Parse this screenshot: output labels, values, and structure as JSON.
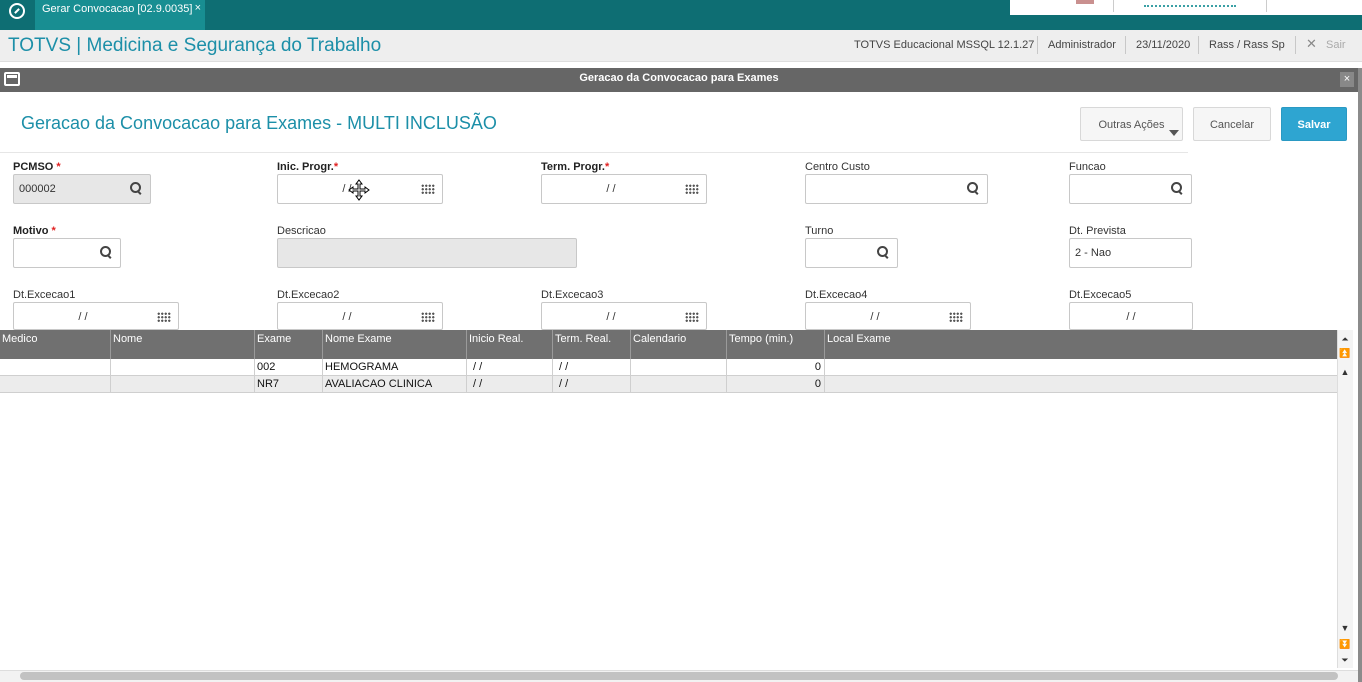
{
  "tab": {
    "label": "Gerar Convocacao [02.9.0035]",
    "close": "×"
  },
  "header": {
    "app_title": "TOTVS | Medicina e Segurança do Trabalho",
    "environment": "TOTVS Educacional MSSQL 12.1.27",
    "user": "Administrador",
    "date": "23/11/2020",
    "branch": "Rass / Rass Sp",
    "exit_label": "Sair"
  },
  "dialog": {
    "title": "Geracao da Convocacao para Exames",
    "close": "×",
    "heading": "Geracao da Convocacao para Exames - MULTI INCLUSÃO",
    "buttons": {
      "other_actions": "Outras Ações",
      "cancel": "Cancelar",
      "save": "Salvar"
    }
  },
  "form": {
    "pcmso": {
      "label": "PCMSO",
      "required": "*",
      "value": "000002"
    },
    "inic_progr": {
      "label": "Inic. Progr.",
      "required": "*",
      "value": "/ /"
    },
    "term_progr": {
      "label": "Term. Progr.",
      "required": "*",
      "value": "/ /"
    },
    "centro_custo": {
      "label": "Centro Custo",
      "value": ""
    },
    "funcao": {
      "label": "Funcao",
      "value": ""
    },
    "motivo": {
      "label": "Motivo",
      "required": "*",
      "value": ""
    },
    "descricao": {
      "label": "Descricao",
      "value": ""
    },
    "turno": {
      "label": "Turno",
      "value": ""
    },
    "dt_prevista": {
      "label": "Dt. Prevista",
      "value": "2 - Nao"
    },
    "dt_excecao1": {
      "label": "Dt.Excecao1",
      "value": "/ /"
    },
    "dt_excecao2": {
      "label": "Dt.Excecao2",
      "value": "/ /"
    },
    "dt_excecao3": {
      "label": "Dt.Excecao3",
      "value": "/ /"
    },
    "dt_excecao4": {
      "label": "Dt.Excecao4",
      "value": "/ /"
    },
    "dt_excecao5": {
      "label": "Dt.Excecao5",
      "value": "/ /"
    }
  },
  "grid": {
    "columns": [
      "Medico",
      "Nome",
      "Exame",
      "Nome Exame",
      "Inicio Real.",
      "Term. Real.",
      "Calendario",
      "Tempo (min.)",
      "Local Exame"
    ],
    "rows": [
      [
        "",
        "",
        "002",
        "HEMOGRAMA",
        "/ /",
        "/ /",
        "",
        "0",
        ""
      ],
      [
        "",
        "",
        "NR7",
        "AVALIACAO CLINICA",
        "/ /",
        "/ /",
        "",
        "0",
        ""
      ]
    ]
  },
  "colors": {
    "topbar": "#0e6e73",
    "accent": "#1c8fa8",
    "save_button": "#2ea5d1",
    "dialog_title_bar": "#666666",
    "grid_header": "#707070",
    "required": "#e02020"
  },
  "icons": [
    "totvs-logo-icon",
    "window-icon",
    "search-icon",
    "calendar-icon",
    "move-cursor-icon",
    "scroll-top-icon",
    "scroll-page-up-icon",
    "scroll-up-icon",
    "scroll-down-icon",
    "scroll-page-down-icon",
    "scroll-bottom-icon"
  ]
}
